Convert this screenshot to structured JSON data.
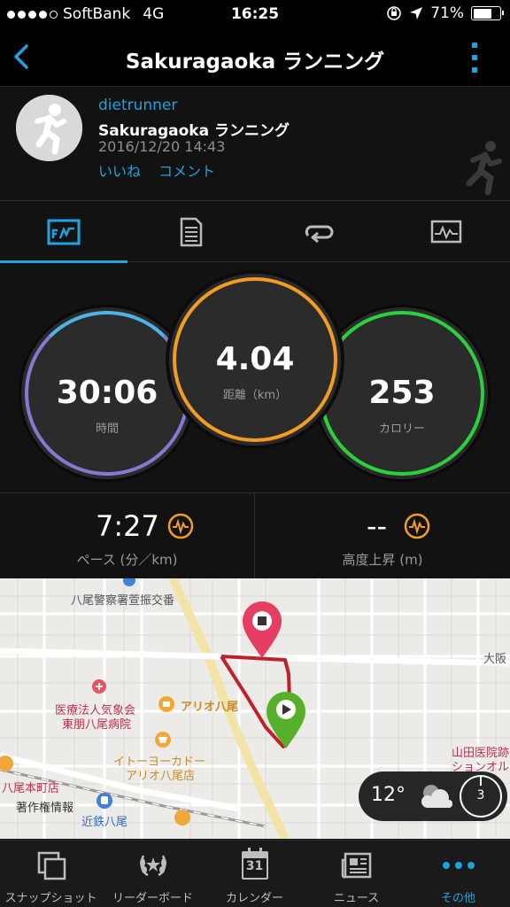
{
  "status_bar": {
    "carrier": "SoftBank",
    "network": "4G",
    "time": "16:25",
    "battery": "71%",
    "battery_level": 0.71
  },
  "nav": {
    "title": "Sakuragaoka ランニング",
    "back_icon": "chevron-left-icon",
    "menu_icon": "more-vertical-icon"
  },
  "header": {
    "username": "dietrunner",
    "activity_name": "Sakuragaoka ランニング",
    "date": "2016/12/20 14:43",
    "like": "いいね",
    "comment": "コメント"
  },
  "tabs": [
    {
      "icon": "overview-chart-icon",
      "active": true
    },
    {
      "icon": "details-document-icon",
      "active": false
    },
    {
      "icon": "laps-loop-icon",
      "active": false
    },
    {
      "icon": "graph-monitor-icon",
      "active": false
    }
  ],
  "stats": {
    "time": {
      "value": "30:06",
      "label": "時間",
      "color": "#8a77d1"
    },
    "distance": {
      "value": "4.04",
      "label": "距離（km）",
      "color": "#f39c22"
    },
    "calories": {
      "value": "253",
      "label": "カロリー",
      "color": "#2bd13c"
    }
  },
  "metrics": {
    "pace": {
      "value": "7:27",
      "label": "ペース (分／km)"
    },
    "elevation": {
      "value": "--",
      "label": "高度上昇 (m)"
    }
  },
  "map": {
    "labels": [
      {
        "text": "八尾警察署萱振交番",
        "color": "#555555"
      },
      {
        "text": "大阪",
        "color": "#555555"
      },
      {
        "text": "アリオ八尾",
        "color": "#c98a2a"
      },
      {
        "text": "医療法人気象会",
        "color": "#c0304a"
      },
      {
        "text": "東朋八尾病院",
        "color": "#c0304a"
      },
      {
        "text": "イトーヨーカドー",
        "color": "#c98a2a"
      },
      {
        "text": "アリオ八尾店",
        "color": "#c98a2a"
      },
      {
        "text": "八尾本町店",
        "color": "#c0304a"
      },
      {
        "text": "著作権情報",
        "color": "#333333"
      },
      {
        "text": "近鉄八尾",
        "color": "#2b6fc2"
      },
      {
        "text": "山田医院跡",
        "color": "#c0304a"
      },
      {
        "text": "ションオル",
        "color": "#c0304a"
      }
    ],
    "weather": {
      "temp": "12°",
      "icon": "cloudy-icon",
      "wind": "3"
    }
  },
  "bottom_nav": [
    {
      "label": "スナップショット",
      "icon": "snapshot-icon",
      "active": false
    },
    {
      "label": "リーダーボード",
      "icon": "leaderboard-laurel-icon",
      "active": false
    },
    {
      "label": "カレンダー",
      "icon": "calendar-icon",
      "active": false,
      "badge": "31"
    },
    {
      "label": "ニュース",
      "icon": "news-icon",
      "active": false
    },
    {
      "label": "その他",
      "icon": "more-dots-icon",
      "active": true
    }
  ],
  "colors": {
    "accent": "#1ea2e0",
    "route": "#c0202a",
    "start_pin": "#57b02a",
    "end_pin": "#e63d63",
    "orange_icon": "#f39c22"
  }
}
